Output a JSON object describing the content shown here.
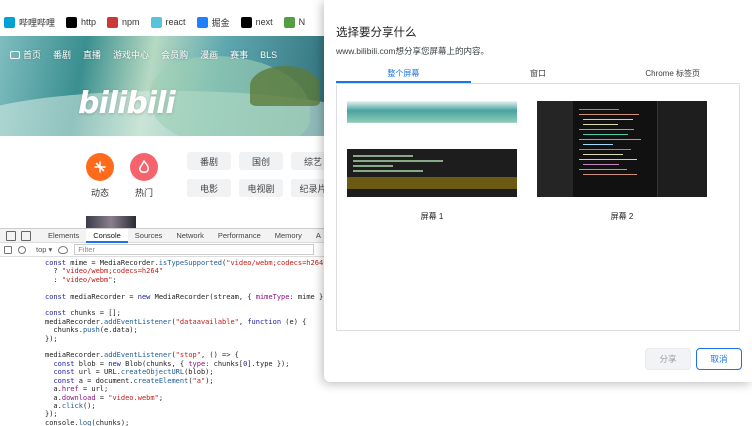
{
  "bookmarks": [
    {
      "label": "哔哩哔哩",
      "icon": "bilibili-tv-icon",
      "color": "#00a1d6"
    },
    {
      "label": "http",
      "icon": "mdn-icon",
      "color": "#000000"
    },
    {
      "label": "npm",
      "icon": "npm-icon",
      "color": "#cb3837"
    },
    {
      "label": "react",
      "icon": "react-icon",
      "color": "#58c4dc"
    },
    {
      "label": "掘金",
      "icon": "juejin-icon",
      "color": "#1e80ff"
    },
    {
      "label": "next",
      "icon": "next-icon",
      "color": "#000000"
    },
    {
      "label": "N",
      "icon": "node-icon",
      "color": "#539e43"
    }
  ],
  "bilibili": {
    "nav": [
      "首页",
      "番剧",
      "直播",
      "游戏中心",
      "会员购",
      "漫画",
      "赛事",
      "BLS"
    ],
    "logo": "bilibili",
    "quick": [
      {
        "label": "动态",
        "icon": "dynamic-icon",
        "color": "#ff6b1a"
      },
      {
        "label": "热门",
        "icon": "fire-icon",
        "color": "#f5646c"
      }
    ],
    "categories": [
      "番剧",
      "国创",
      "综艺",
      "电影",
      "电视剧",
      "纪录片"
    ]
  },
  "devtools": {
    "tabs": [
      "Elements",
      "Console",
      "Sources",
      "Network",
      "Performance",
      "Memory",
      "A"
    ],
    "active_tab": "Console",
    "context": "top ▾",
    "filter_placeholder": "Filter"
  },
  "dialog": {
    "title": "选择要分享什么",
    "subtitle": "www.bilibili.com想分享您屏幕上的内容。",
    "tabs": [
      "整个屏幕",
      "窗口",
      "Chrome 标签页"
    ],
    "active_tab": "整个屏幕",
    "screens": [
      "屏幕 1",
      "屏幕 2"
    ],
    "share_button": "分享",
    "cancel_button": "取消",
    "accent_color": "#1a73e8"
  }
}
